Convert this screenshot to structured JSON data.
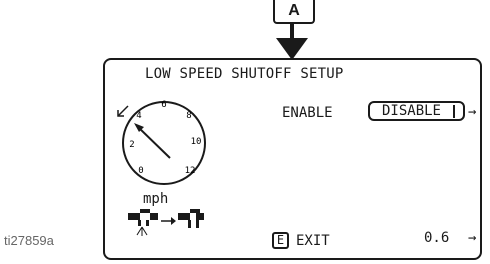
{
  "callout": {
    "letter": "A"
  },
  "screen": {
    "title": "LOW SPEED SHUTOFF SETUP",
    "enable_label": "ENABLE",
    "enable_value": "DISABLE",
    "enable_arrow": "→",
    "gauge": {
      "tick_labels": [
        "0",
        "2",
        "4",
        "6",
        "8",
        "10",
        "12"
      ],
      "unit": "mph",
      "needle_value": 4
    },
    "exit_key": "E",
    "exit_label": "EXIT",
    "value": "0.6",
    "value_arrow": "→",
    "icons": [
      "low-speed-gauge-icon",
      "low-speed-transition-icon",
      "callout-arrow-icon"
    ]
  },
  "figure_id": "ti27859a"
}
